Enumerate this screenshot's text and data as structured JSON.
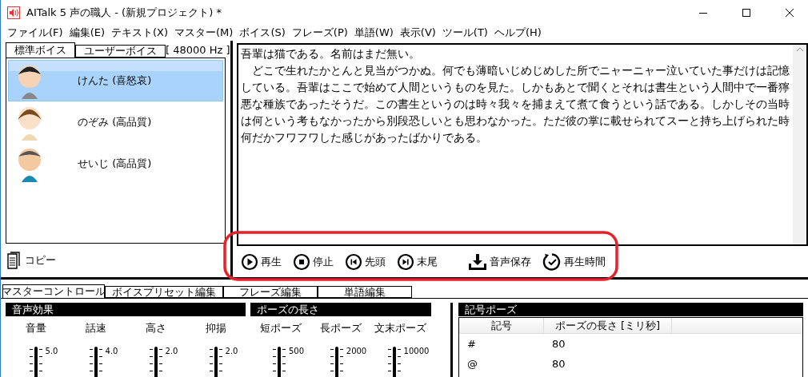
{
  "window": {
    "title": "AITalk 5 声の職人 - (新規プロジェクト) *"
  },
  "menu": [
    "ファイル(F)",
    "編集(E)",
    "テキスト(X)",
    "マスター(M)",
    "ボイス(S)",
    "フレーズ(P)",
    "単語(W)",
    "表示(V)",
    "ツール(T)",
    "ヘルプ(H)"
  ],
  "voice_tabs": [
    {
      "label": "標準ボイス",
      "selected": true
    },
    {
      "label": "ユーザーボイス",
      "selected": false
    }
  ],
  "sample_rate": "[ 48000 Hz ]",
  "voices": [
    {
      "name": "けんた (喜怒哀)",
      "selected": true
    },
    {
      "name": "のぞみ (高品質)",
      "selected": false
    },
    {
      "name": "せいじ (高品質)",
      "selected": false
    }
  ],
  "copy_button": "コピー",
  "editor": {
    "paragraphs": [
      "吾輩は猫である。名前はまだ無い。",
      "　どこで生れたかとんと見当がつかぬ。何でも薄暗いじめじめした所でニャーニャー泣いていた事だけは記憶している。吾輩はここで始めて人間というものを見た。しかもあとで聞くとそれは書生という人間中で一番獰悪な種族であったそうだ。この書生というのは時々我々を捕まえて煮て食うという話である。しかしその当時は何という考もなかったから別段恐しいとも思わなかった。ただ彼の掌に載せられてスーと持ち上げられた時何だかフワフワした感じがあったばかりである。"
    ]
  },
  "playback_buttons": [
    {
      "label": "再生",
      "kind": "play"
    },
    {
      "label": "停止",
      "kind": "stop"
    },
    {
      "label": "先頭",
      "kind": "first"
    },
    {
      "label": "末尾",
      "kind": "last"
    },
    {
      "label": "音声保存",
      "kind": "save"
    },
    {
      "label": "再生時間",
      "kind": "time"
    }
  ],
  "bottom_tabs": [
    {
      "label": "マスターコントロール",
      "selected": true
    },
    {
      "label": "ボイスプリセット編集",
      "selected": false
    },
    {
      "label": "フレーズ編集",
      "selected": false
    },
    {
      "label": "単語編集",
      "selected": false
    }
  ],
  "effects": {
    "title": "音声効果",
    "sliders": [
      {
        "label": "音量",
        "tick": "5.0"
      },
      {
        "label": "話速",
        "tick": "4.0"
      },
      {
        "label": "高さ",
        "tick": "2.0"
      },
      {
        "label": "抑揚",
        "tick": "2.0"
      }
    ]
  },
  "pause": {
    "title": "ポーズの長さ",
    "sliders": [
      {
        "label": "短ポーズ",
        "tick": "500"
      },
      {
        "label": "長ポーズ",
        "tick": "2000"
      },
      {
        "label": "文末ポーズ",
        "tick": "10000"
      }
    ]
  },
  "symbol_pause": {
    "title": "記号ポーズ",
    "columns": [
      "記号",
      "ポーズの長さ [ミリ秒]"
    ],
    "rows": [
      [
        "#",
        "80"
      ],
      [
        "@",
        "80"
      ]
    ]
  }
}
